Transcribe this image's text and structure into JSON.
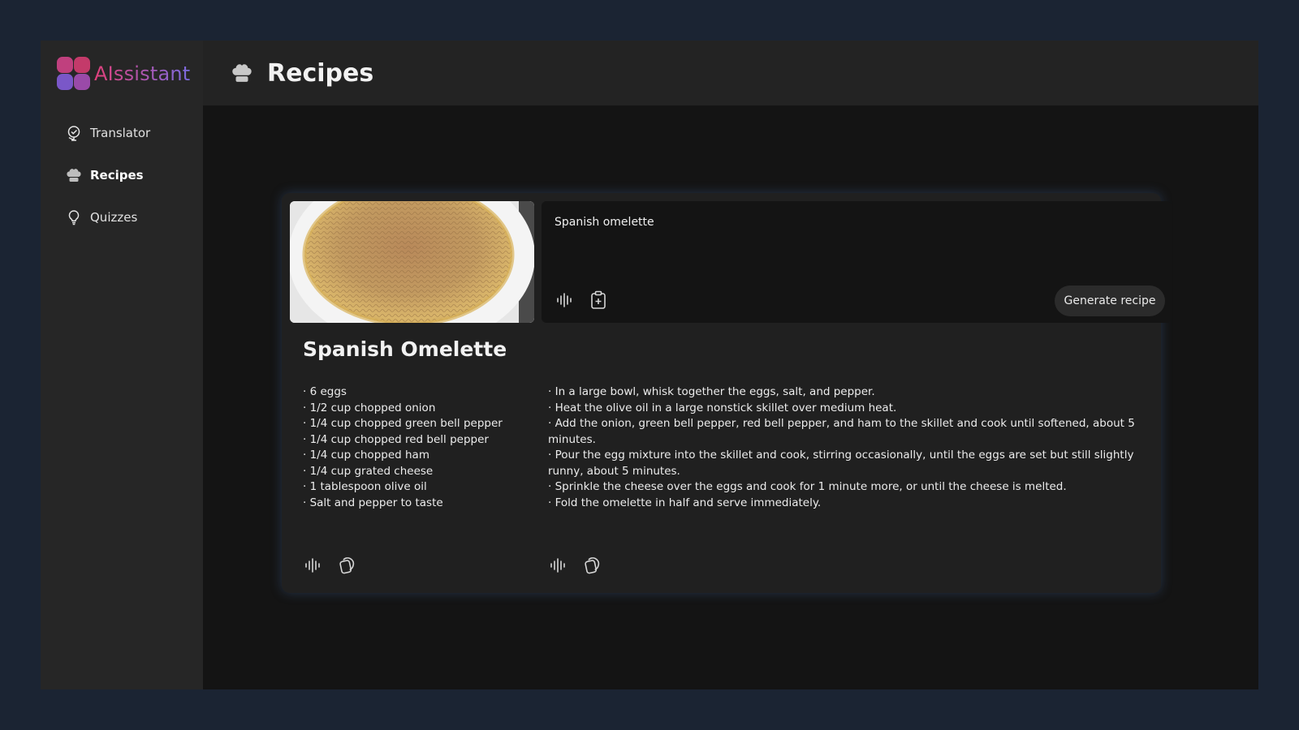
{
  "app": {
    "name": "AIssistant"
  },
  "nav": {
    "items": [
      {
        "label": "Translator",
        "icon": "globe-check-icon",
        "active": false
      },
      {
        "label": "Recipes",
        "icon": "chef-hat-icon",
        "active": true
      },
      {
        "label": "Quizzes",
        "icon": "lightbulb-icon",
        "active": false
      }
    ]
  },
  "header": {
    "title": "Recipes",
    "icon": "chef-hat-icon"
  },
  "prompt": {
    "value": "Spanish omelette",
    "generate_label": "Generate recipe",
    "image": "spanish-omelette-photo"
  },
  "recipe": {
    "title": "Spanish Omelette",
    "ingredients": [
      "6 eggs",
      "1/2 cup chopped onion",
      "1/4 cup chopped green bell pepper",
      "1/4 cup chopped red bell pepper",
      "1/4 cup chopped ham",
      "1/4 cup grated cheese",
      "1 tablespoon olive oil",
      "Salt and pepper to taste"
    ],
    "steps": [
      "In a large bowl, whisk together the eggs, salt, and pepper.",
      "Heat the olive oil in a large nonstick skillet over medium heat.",
      "Add the onion, green bell pepper, red bell pepper, and ham to the skillet and cook until softened, about 5 minutes.",
      "Pour the egg mixture into the skillet and cook, stirring occasionally, until the eggs are set but still slightly runny, about 5 minutes.",
      "Sprinkle the cheese over the eggs and cook for 1 minute more, or until the cheese is melted.",
      "Fold the omelette in half and serve immediately."
    ]
  },
  "colors": {
    "background": "#1b2433",
    "sidebar": "#262626",
    "panel": "#202020",
    "accent_pink": "#e0407a",
    "accent_purple": "#7b6be0"
  }
}
